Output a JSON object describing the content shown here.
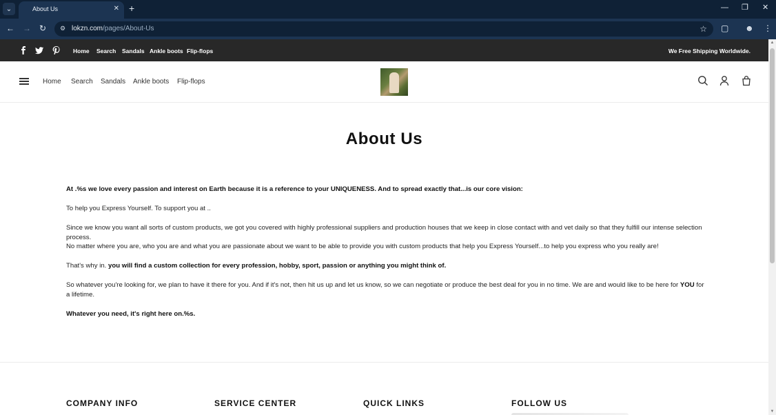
{
  "browser": {
    "tab_title": "About Us",
    "url_host": "lokzn.com",
    "url_path": "/pages/About-Us"
  },
  "announcement": {
    "links": [
      "Home",
      "Search",
      "Sandals",
      "Ankle boots",
      "Flip-flops"
    ],
    "shipping": "We Free Shipping Worldwide."
  },
  "header": {
    "nav": [
      "Home",
      "Search",
      "Sandals",
      "Ankle boots",
      "Flip-flops"
    ]
  },
  "page": {
    "title": "About Us",
    "p1": "At .%s we love every passion and interest on Earth because it is a reference to your UNIQUENESS. And to spread exactly that...is our core vision:",
    "p2": "To help you Express Yourself. To support you at ..",
    "p3": "Since we know you want all sorts of custom products, we got you covered with highly professional suppliers and production houses that we keep in close contact with and vet daily so that they fulfill our intense selection process.",
    "p4": "No matter where you are, who you are and what you are passionate about we want to be able to provide you with custom products that help you Express Yourself...to help you express who you really are!",
    "p5_lead": "That's why in. ",
    "p5_bold": "you will find a custom collection for every profession, hobby, sport, passion or anything you might think of.",
    "p6_a": "So whatever you're looking for, we plan to have it there for you. And if it's not, then hit us up and let us know, so we can negotiate or produce the best deal for you in no time. We are and would like to be here for ",
    "p6_you": "YOU",
    "p6_b": " for a lifetime.",
    "p7": "Whatever you need, it's right here on.%s."
  },
  "footer": {
    "columns": [
      "COMPANY INFO",
      "SERVICE CENTER",
      "QUICK LINKS",
      "FOLLOW US"
    ]
  }
}
